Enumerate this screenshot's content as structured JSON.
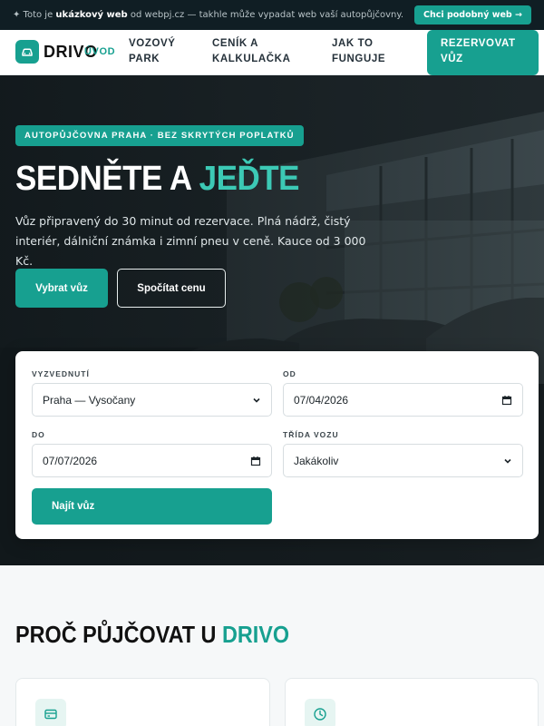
{
  "promo": {
    "prefix": "✦ Toto je ",
    "highlight": "ukázkový web",
    "suffix": " od webpj.cz — takhle může vypadat web vaší autopůjčovny.",
    "button": "Chci podobný web →"
  },
  "header": {
    "logo_text": "DRIVO",
    "nav": [
      "Úvod",
      "Vozový park",
      "Ceník a kalkulačka",
      "Jak to funguje"
    ],
    "cta": "Rezervovat vůz"
  },
  "hero": {
    "badge": "AUTOPŮJČOVNA PRAHA · BEZ SKRYTÝCH POPLATKŮ",
    "title_main": "SEDNĚTE A ",
    "title_accent": "JEĎTE",
    "subtitle": "Vůz připravený do 30 minut od rezervace. Plná nádrž, čistý interiér, dálniční známka i zimní pneu v ceně. Kauce od 3 000 Kč.",
    "btn_primary": "Vybrat vůz",
    "btn_secondary": "Spočítat cenu"
  },
  "search": {
    "pickup_label": "Vyzvednutí",
    "pickup_value": "Praha — Vysočany",
    "from_label": "Od",
    "from_value": "07/04/2026",
    "to_label": "Do",
    "to_value": "07/07/2026",
    "class_label": "Třída vozu",
    "class_value": "Jakákoliv",
    "submit": "Najít vůz"
  },
  "why": {
    "title_main": "PROČ PŮJČOVAT U ",
    "title_accent": "DRIVO",
    "features": [
      {
        "icon": "credit-card-icon"
      },
      {
        "icon": "clock-icon"
      }
    ]
  },
  "colors": {
    "accent": "#17a090",
    "accent_light": "#3cc9b5",
    "dark": "#101e24"
  }
}
